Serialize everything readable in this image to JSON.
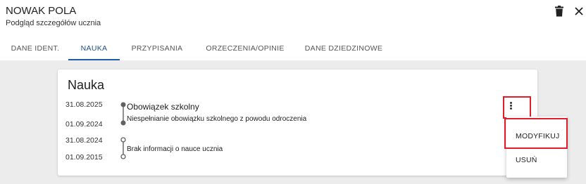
{
  "header": {
    "name": "NOWAK POLA",
    "subtitle": "Podgląd szczegółów ucznia",
    "icons": {
      "delete": "trash-icon",
      "close": "close-icon"
    }
  },
  "tabs": [
    {
      "label": "DANE IDENT."
    },
    {
      "label": "NAUKA",
      "active": true
    },
    {
      "label": "PRZYPISANIA"
    },
    {
      "label": "ORZECZENIA/OPINIE"
    },
    {
      "label": "DANE DZIEDZINOWE"
    }
  ],
  "card": {
    "title": "Nauka",
    "entries": [
      {
        "date_end": "31.08.2025",
        "date_start": "01.09.2024",
        "title": "Obowiązek szkolny",
        "description": "Niespełnianie obowiązku szkolnego z powodu odroczenia",
        "marker": "filled"
      },
      {
        "date_end": "31.08.2024",
        "date_start": "01.09.2015",
        "title": "",
        "description": "Brak informacji o nauce ucznia",
        "marker": "hollow"
      }
    ]
  },
  "menu": {
    "icon": "more-vert-icon",
    "items": [
      {
        "label": "MODYFIKUJ",
        "highlighted": true
      },
      {
        "label": "USUŃ"
      }
    ]
  },
  "colors": {
    "accent": "#1e5ea8",
    "highlight": "#e11d2c",
    "background": "#ececec"
  }
}
